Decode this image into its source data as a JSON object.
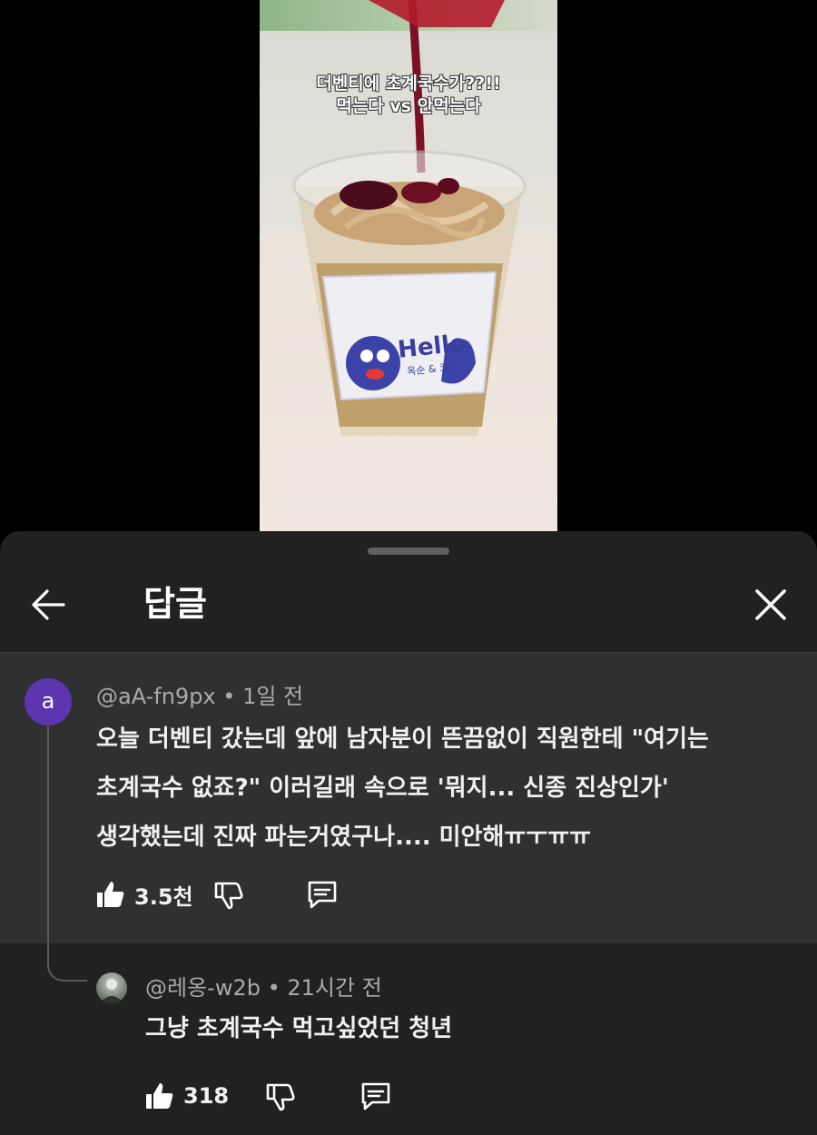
{
  "video": {
    "caption_line1": "더벤티에 초계국수가??!!",
    "caption_line2": "먹는다 vs 안먹는다",
    "cup_brand": "Hello",
    "cup_subtitle": "옥순 & 코비"
  },
  "header": {
    "title": "답글",
    "back_icon": "arrow-left-icon",
    "close_icon": "close-icon"
  },
  "parent_comment": {
    "avatar_letter": "a",
    "avatar_color": "#5e35b1",
    "author": "@aA-fn9px",
    "separator": "•",
    "time": "1일 전",
    "text_lines": [
      "오늘 더벤티 갔는데 앞에 남자분이 뜬끔없이 직원한테 \"여기는",
      "초계국수 없죠?\" 이러길래 속으로 '뭐지... 신종 진상인가'",
      "생각했는데 진짜 파는거였구나.... 미안해ㅠㅜㅠㅠ"
    ],
    "likes": "3.5천"
  },
  "reply": {
    "author": "@레옹-w2b",
    "separator": "•",
    "time": "21시간 전",
    "text": "그냥 초계국수 먹고싶었던 청년",
    "likes": "318"
  },
  "colors": {
    "sheet_bg": "#212121",
    "highlight_bg": "#303030",
    "meta_text": "#aaaaaa"
  }
}
